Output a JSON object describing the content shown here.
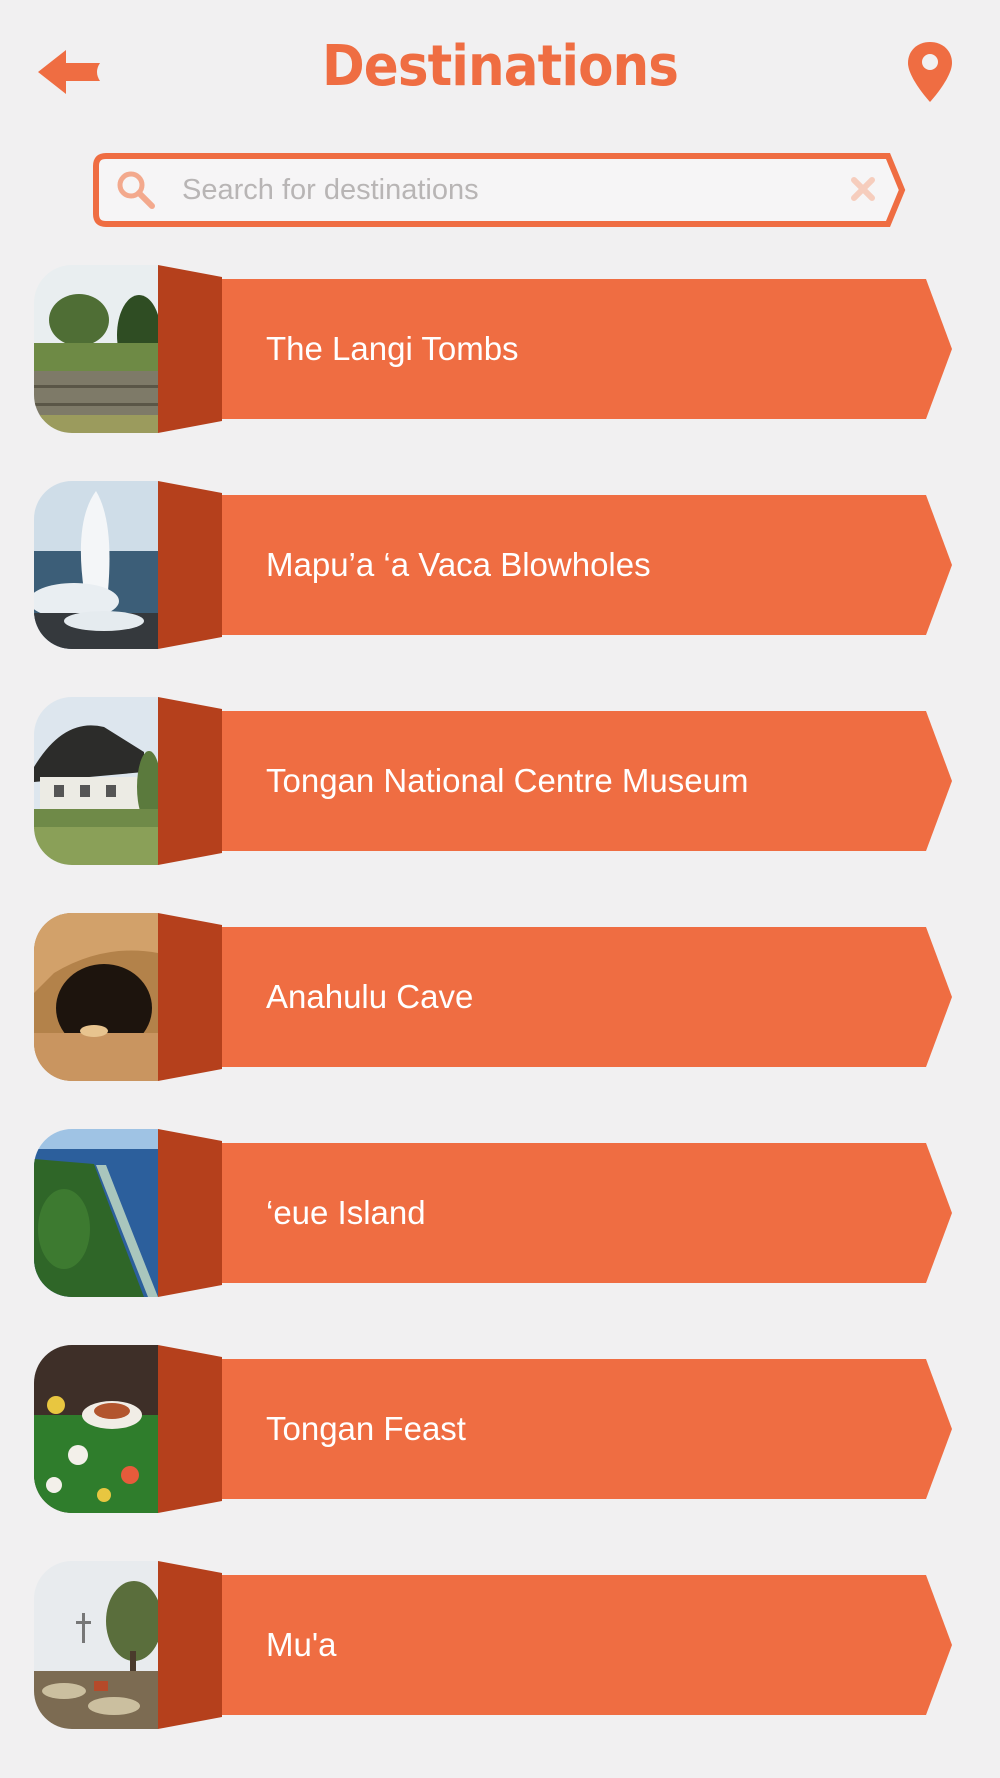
{
  "header": {
    "title": "Destinations",
    "back_icon": "back-arrow-icon",
    "map_icon": "map-pin-icon"
  },
  "search": {
    "placeholder": "Search for destinations",
    "value": "",
    "search_icon": "magnifier-icon",
    "clear_icon": "close-icon"
  },
  "colors": {
    "accent": "#ef6d42",
    "accent_dark": "#b5401c",
    "background": "#f1f0f1",
    "placeholder": "#b8b5b5"
  },
  "destinations": [
    {
      "label": "The Langi Tombs",
      "thumb": "stone-tomb-terraces-photo"
    },
    {
      "label": "Mapu’a ‘a Vaca Blowholes",
      "thumb": "ocean-blowhole-spray-photo"
    },
    {
      "label": "Tongan National Centre Museum",
      "thumb": "thatched-museum-building-photo"
    },
    {
      "label": "Anahulu Cave",
      "thumb": "cave-interior-photo"
    },
    {
      "label": "‘eue Island",
      "thumb": "island-coastline-aerial-photo"
    },
    {
      "label": "Tongan Feast",
      "thumb": "feast-food-table-photo"
    },
    {
      "label": "Mu'a",
      "thumb": "graveyard-trees-photo"
    }
  ]
}
